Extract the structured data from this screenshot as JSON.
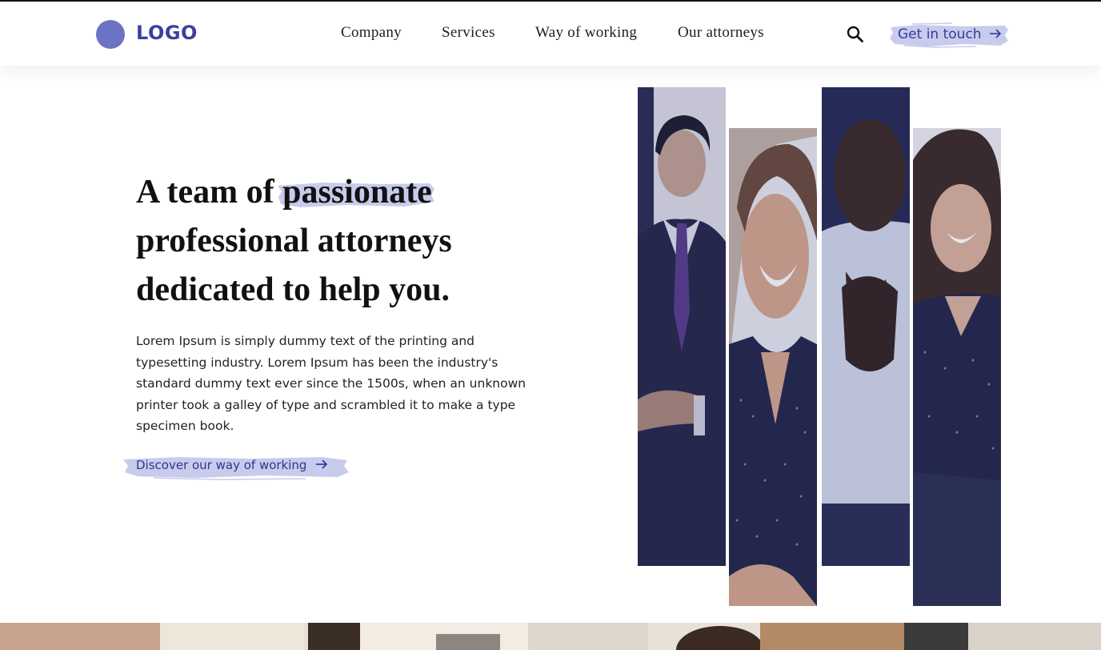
{
  "header": {
    "logo_text": "LOGO",
    "nav": [
      {
        "label": "Company"
      },
      {
        "label": "Services"
      },
      {
        "label": "Way of working"
      },
      {
        "label": "Our attorneys"
      }
    ],
    "search_icon": "search-icon",
    "cta_label": "Get in touch",
    "cta_icon": "arrow-right-icon"
  },
  "hero": {
    "title_pre": "A team of ",
    "title_highlight": "passionate",
    "title_post": "professional attorneys dedicated to help you.",
    "body": "Lorem Ipsum is simply dummy text of the printing and typesetting industry. Lorem Ipsum has been the industry's standard dummy text ever since the 1500s, when an unknown printer took a galley of type and scrambled it to make a type specimen book.",
    "link_label": "Discover our way of working",
    "link_icon": "arrow-right-icon"
  },
  "colors": {
    "brand": "#3b40a0",
    "logo_circle": "#6c73c4",
    "highlight": "#c9cbec",
    "photo_tint": "#2b2f66"
  }
}
